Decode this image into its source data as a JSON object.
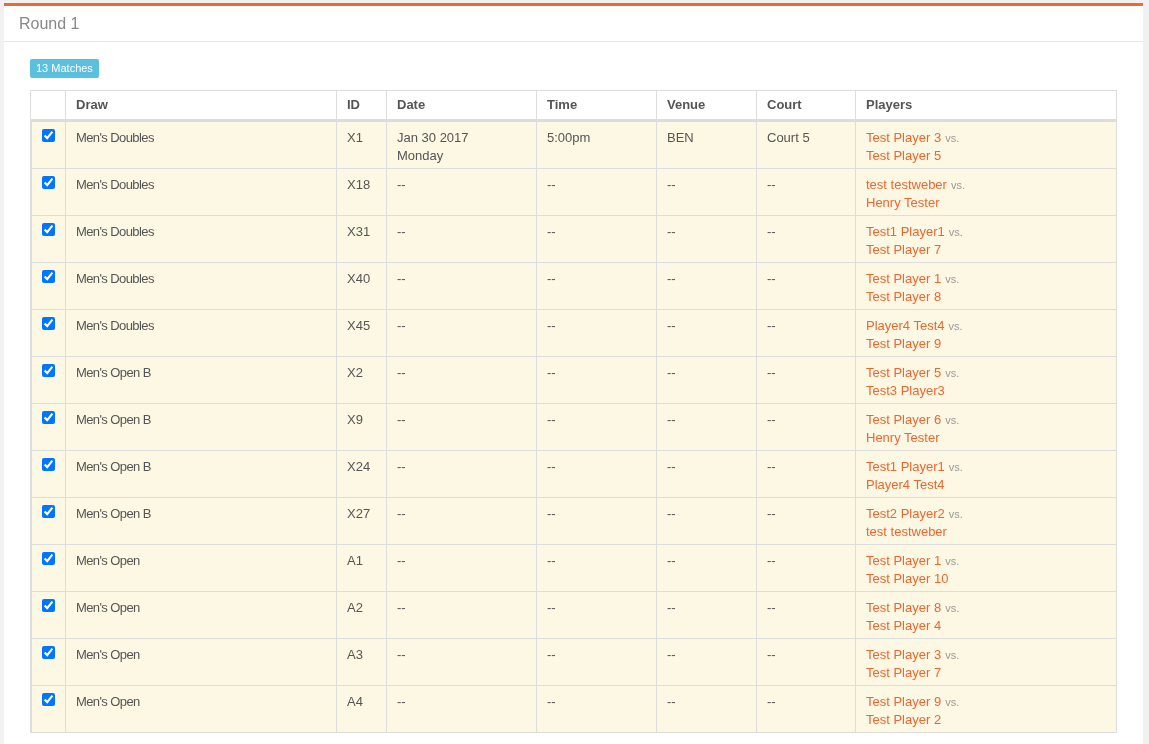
{
  "panel": {
    "title": "Round 1"
  },
  "badge": "13 Matches",
  "table": {
    "columns": [
      "Draw",
      "ID",
      "Date",
      "Time",
      "Venue",
      "Court",
      "Players"
    ],
    "rows": [
      {
        "checked": true,
        "draw": "Men's Doubles",
        "id": "X1",
        "date": "Jan 30 2017",
        "weekday": "Monday",
        "time": "5:00pm",
        "venue": "BEN",
        "court": "Court 5",
        "player_1": "Test Player 3",
        "vs": "vs.",
        "player_2": "Test Player 5"
      },
      {
        "checked": true,
        "draw": "Men's Doubles",
        "id": "X18",
        "date": "--",
        "time": "--",
        "venue": "--",
        "court": "--",
        "player_1": "test testweber",
        "vs": "vs.",
        "player_2": "Henry Tester"
      },
      {
        "checked": true,
        "draw": "Men's Doubles",
        "id": "X31",
        "date": "--",
        "time": "--",
        "venue": "--",
        "court": "--",
        "player_1": "Test1 Player1",
        "vs": "vs.",
        "player_2": "Test Player 7"
      },
      {
        "checked": true,
        "draw": "Men's Doubles",
        "id": "X40",
        "date": "--",
        "time": "--",
        "venue": "--",
        "court": "--",
        "player_1": "Test Player 1",
        "vs": "vs.",
        "player_2": "Test Player 8"
      },
      {
        "checked": true,
        "draw": "Men's Doubles",
        "id": "X45",
        "date": "--",
        "time": "--",
        "venue": "--",
        "court": "--",
        "player_1": "Player4 Test4",
        "vs": "vs.",
        "player_2": "Test Player 9"
      },
      {
        "checked": true,
        "draw": "Men's Open B",
        "id": "X2",
        "date": "--",
        "time": "--",
        "venue": "--",
        "court": "--",
        "player_1": "Test Player 5",
        "vs": "vs.",
        "player_2": "Test3 Player3"
      },
      {
        "checked": true,
        "draw": "Men's Open B",
        "id": "X9",
        "date": "--",
        "time": "--",
        "venue": "--",
        "court": "--",
        "player_1": "Test Player 6",
        "vs": "vs.",
        "player_2": "Henry Tester"
      },
      {
        "checked": true,
        "draw": "Men's Open B",
        "id": "X24",
        "date": "--",
        "time": "--",
        "venue": "--",
        "court": "--",
        "player_1": "Test1 Player1",
        "vs": "vs.",
        "player_2": "Player4 Test4"
      },
      {
        "checked": true,
        "draw": "Men's Open B",
        "id": "X27",
        "date": "--",
        "time": "--",
        "venue": "--",
        "court": "--",
        "player_1": "Test2 Player2",
        "vs": "vs.",
        "player_2": "test testweber"
      },
      {
        "checked": true,
        "draw": "Men's Open",
        "id": "A1",
        "date": "--",
        "time": "--",
        "venue": "--",
        "court": "--",
        "player_1": "Test Player 1",
        "vs": "vs.",
        "player_2": "Test Player 10"
      },
      {
        "checked": true,
        "draw": "Men's Open",
        "id": "A2",
        "date": "--",
        "time": "--",
        "venue": "--",
        "court": "--",
        "player_1": "Test Player 8",
        "vs": "vs.",
        "player_2": "Test Player 4"
      },
      {
        "checked": true,
        "draw": "Men's Open",
        "id": "A3",
        "date": "--",
        "time": "--",
        "venue": "--",
        "court": "--",
        "player_1": "Test Player 3",
        "vs": "vs.",
        "player_2": "Test Player 7"
      },
      {
        "checked": true,
        "draw": "Men's Open",
        "id": "A4",
        "date": "--",
        "time": "--",
        "venue": "--",
        "court": "--",
        "player_1": "Test Player 9",
        "vs": "vs.",
        "player_2": "Test Player 2"
      }
    ]
  }
}
